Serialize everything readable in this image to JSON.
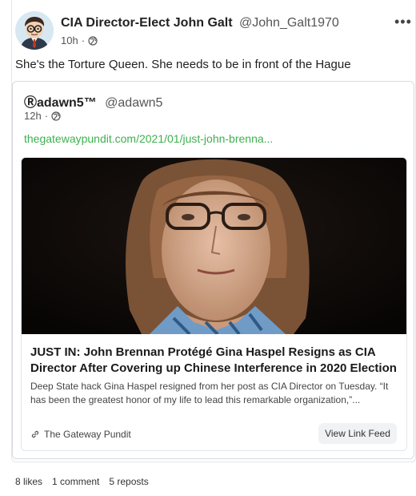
{
  "post": {
    "author_name": "CIA Director-Elect John Galt",
    "author_handle": "@John_Galt1970",
    "timestamp": "10h",
    "separator": "·",
    "visibility_icon": "globe-icon",
    "more_icon": "more-options-icon",
    "more_glyph": "•••",
    "text": "She's the Torture Queen. She needs to be in front of the Hague"
  },
  "quote": {
    "author_name": "Ⓡadawn5™",
    "author_handle": "@adawn5",
    "timestamp": "12h",
    "separator": "·",
    "link_text": "thegatewaypundit.com/2021/01/just-john-brenna...",
    "link_color": "#3eb04e",
    "preview": {
      "title": "JUST IN: John Brennan Protégé Gina Haspel Resigns as CIA Director After Covering up Chinese Interference in 2020 Election",
      "description": "Deep State hack Gina Haspel resigned from her post as CIA Director on Tuesday. “It has been the greatest honor of my life to lead this remarkable organization,”...",
      "source": "The Gateway Pundit",
      "view_feed_label": "View Link Feed"
    }
  },
  "stats": {
    "likes": "8 likes",
    "comments": "1 comment",
    "reposts": "5 reposts"
  }
}
